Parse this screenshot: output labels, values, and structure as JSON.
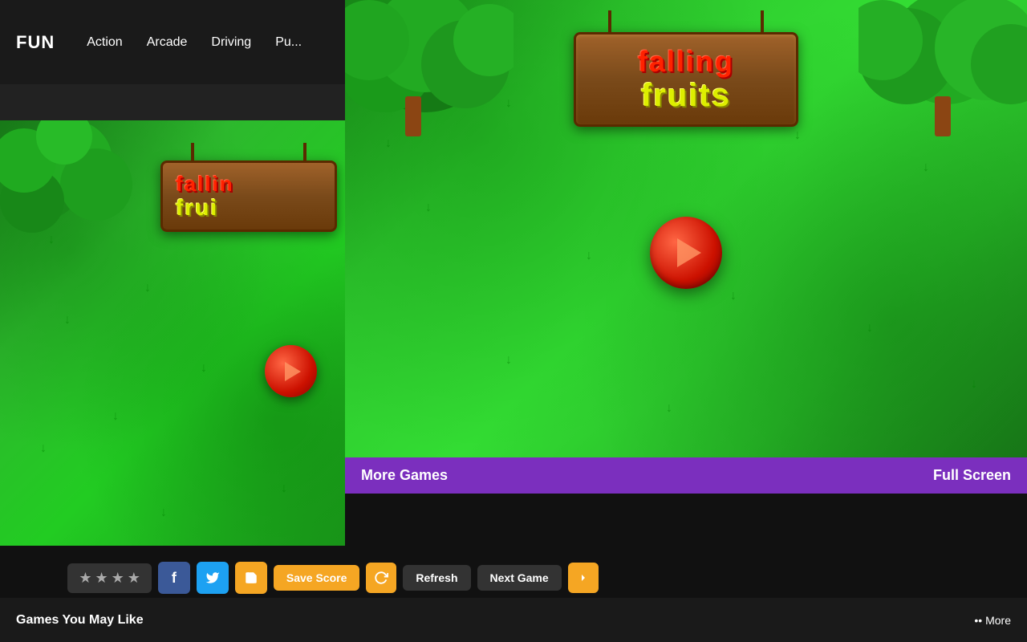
{
  "navbar": {
    "logo": "FUN",
    "links": [
      "Action",
      "Arcade",
      "Driving",
      "Pu..."
    ]
  },
  "game": {
    "title_line1": "falling",
    "title_line2": "fruits"
  },
  "purple_bar": {
    "more_games": "More Games",
    "full_screen": "Full Screen"
  },
  "toolbar": {
    "save_score_label": "Save Score",
    "refresh_label": "Refresh",
    "next_game_label": "Next Game"
  },
  "bottom": {
    "games_label": "Games You May Like",
    "more_label": "•• More"
  }
}
